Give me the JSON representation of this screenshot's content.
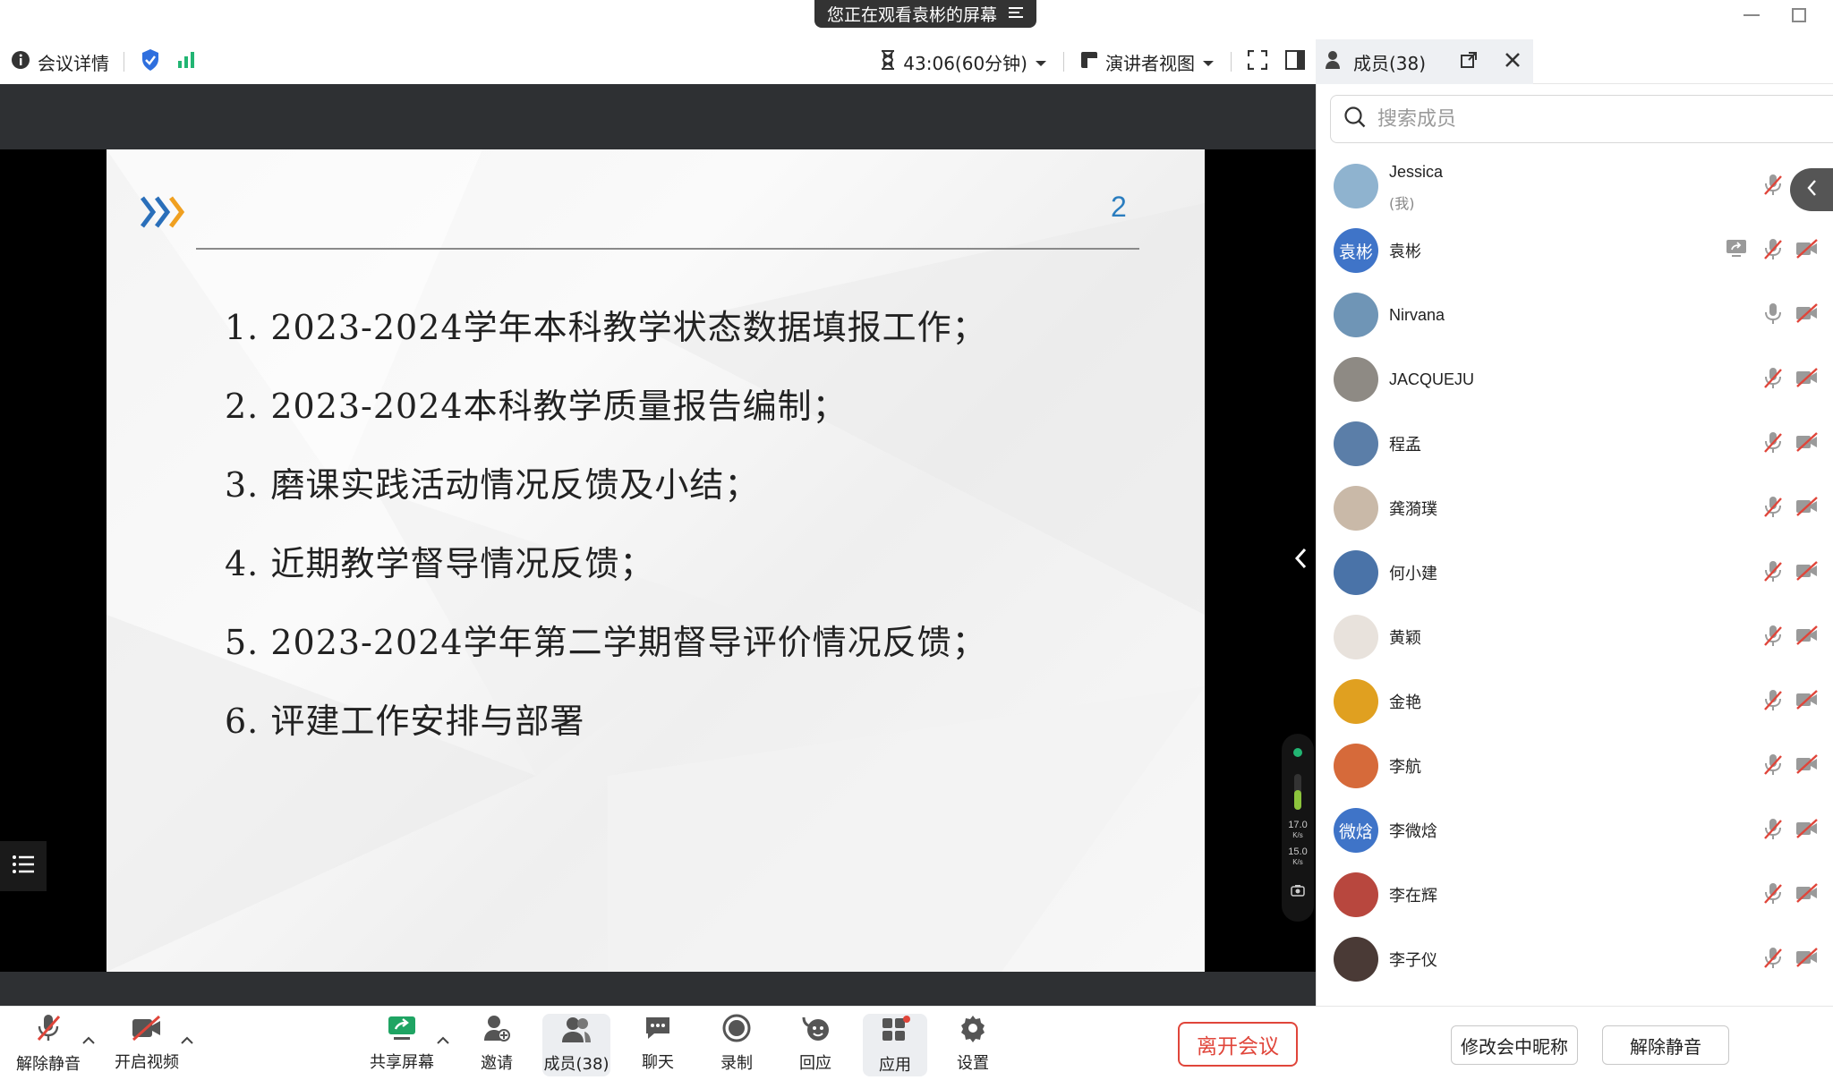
{
  "window": {
    "share_banner": "您正在观看袁彬的屏幕"
  },
  "toolbar": {
    "meeting_info": "会议详情",
    "timer": "43:06(60分钟)",
    "view_mode": "演讲者视图"
  },
  "panel": {
    "header": "成员(38)",
    "search_placeholder": "搜索成员",
    "rename_button": "修改会中昵称",
    "unmute_all_button": "解除静音",
    "members": [
      {
        "name": "Jessica",
        "sub": "(我)",
        "avatar_text": "",
        "avatar_color": "#8fb3cf",
        "mic": "muted",
        "cam": "off"
      },
      {
        "name": "袁彬",
        "sub": "",
        "avatar_text": "袁彬",
        "avatar_color": "#3f74c8",
        "mic": "muted",
        "cam": "off",
        "sharing": true
      },
      {
        "name": "Nirvana",
        "sub": "",
        "avatar_text": "",
        "avatar_color": "#6f95b6",
        "mic": "on",
        "cam": "off"
      },
      {
        "name": "JACQUEJU",
        "sub": "",
        "avatar_text": "",
        "avatar_color": "#8e8a84",
        "mic": "muted",
        "cam": "off"
      },
      {
        "name": "程孟",
        "sub": "",
        "avatar_text": "",
        "avatar_color": "#5b7ea8",
        "mic": "muted",
        "cam": "off"
      },
      {
        "name": "龚漪璞",
        "sub": "",
        "avatar_text": "",
        "avatar_color": "#c9b9a8",
        "mic": "muted",
        "cam": "off"
      },
      {
        "name": "何小建",
        "sub": "",
        "avatar_text": "",
        "avatar_color": "#4a73a8",
        "mic": "muted",
        "cam": "off"
      },
      {
        "name": "黄颖",
        "sub": "",
        "avatar_text": "",
        "avatar_color": "#e8e2dc",
        "mic": "muted",
        "cam": "off"
      },
      {
        "name": "金艳",
        "sub": "",
        "avatar_text": "",
        "avatar_color": "#e0a020",
        "mic": "muted",
        "cam": "off"
      },
      {
        "name": "李航",
        "sub": "",
        "avatar_text": "",
        "avatar_color": "#d66a3a",
        "mic": "muted",
        "cam": "off"
      },
      {
        "name": "李微焓",
        "sub": "",
        "avatar_text": "微焓",
        "avatar_color": "#3f74c8",
        "mic": "muted",
        "cam": "off"
      },
      {
        "name": "李在辉",
        "sub": "",
        "avatar_text": "",
        "avatar_color": "#b8473e",
        "mic": "muted",
        "cam": "off"
      },
      {
        "name": "李子仪",
        "sub": "",
        "avatar_text": "",
        "avatar_color": "#4a3a36",
        "mic": "muted",
        "cam": "off"
      }
    ]
  },
  "slide": {
    "page_number": "2",
    "items": [
      "1. 2023-2024学年本科教学状态数据填报工作；",
      "2. 2023-2024本科教学质量报告编制；",
      "3. 磨课实践活动情况反馈及小结；",
      "4. 近期教学督导情况反馈；",
      "5. 2023-2024学年第二学期督导评价情况反馈；",
      "6. 评建工作安排与部署"
    ]
  },
  "network": {
    "up": "17.0",
    "down": "15.0",
    "unit": "K/s"
  },
  "bottombar": {
    "unmute": "解除静音",
    "start_video": "开启视频",
    "share_screen": "共享屏幕",
    "invite": "邀请",
    "members": "成员(38)",
    "chat": "聊天",
    "record": "录制",
    "reply": "回应",
    "apps": "应用",
    "settings": "设置",
    "leave": "离开会议"
  },
  "colors": {
    "accent_blue": "#3f74c8",
    "leave_red": "#e0453a",
    "signal_green": "#22b573",
    "slide_number_blue": "#2a7dbf"
  }
}
